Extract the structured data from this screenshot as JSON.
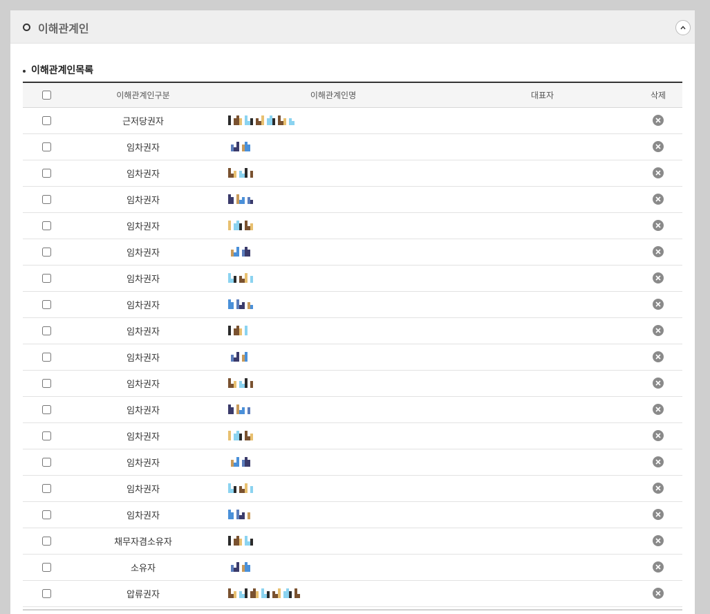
{
  "panel": {
    "title": "이해관계인"
  },
  "section": {
    "title": "이해관계인목록"
  },
  "table": {
    "headers": {
      "type": "이해관계인구분",
      "name": "이해관계인명",
      "rep": "대표자",
      "delete": "삭제"
    },
    "rows": [
      {
        "type": "근저당권자",
        "rep": ""
      },
      {
        "type": "임차권자",
        "rep": ""
      },
      {
        "type": "임차권자",
        "rep": ""
      },
      {
        "type": "임차권자",
        "rep": ""
      },
      {
        "type": "임차권자",
        "rep": ""
      },
      {
        "type": "임차권자",
        "rep": ""
      },
      {
        "type": "임차권자",
        "rep": ""
      },
      {
        "type": "임차권자",
        "rep": ""
      },
      {
        "type": "임차권자",
        "rep": ""
      },
      {
        "type": "임차권자",
        "rep": ""
      },
      {
        "type": "임차권자",
        "rep": ""
      },
      {
        "type": "임차권자",
        "rep": ""
      },
      {
        "type": "임차권자",
        "rep": ""
      },
      {
        "type": "임차권자",
        "rep": ""
      },
      {
        "type": "임차권자",
        "rep": ""
      },
      {
        "type": "임차권자",
        "rep": ""
      },
      {
        "type": "채무자겸소유자",
        "rep": ""
      },
      {
        "type": "소유자",
        "rep": ""
      },
      {
        "type": "압류권자",
        "rep": ""
      }
    ]
  },
  "colors": {
    "header_bg": "#efefef",
    "delete_icon": "#8a8a8a",
    "table_top_border": "#333333"
  },
  "icons": {
    "collapse": "chevron-up-icon",
    "delete": "close-circle-icon"
  }
}
